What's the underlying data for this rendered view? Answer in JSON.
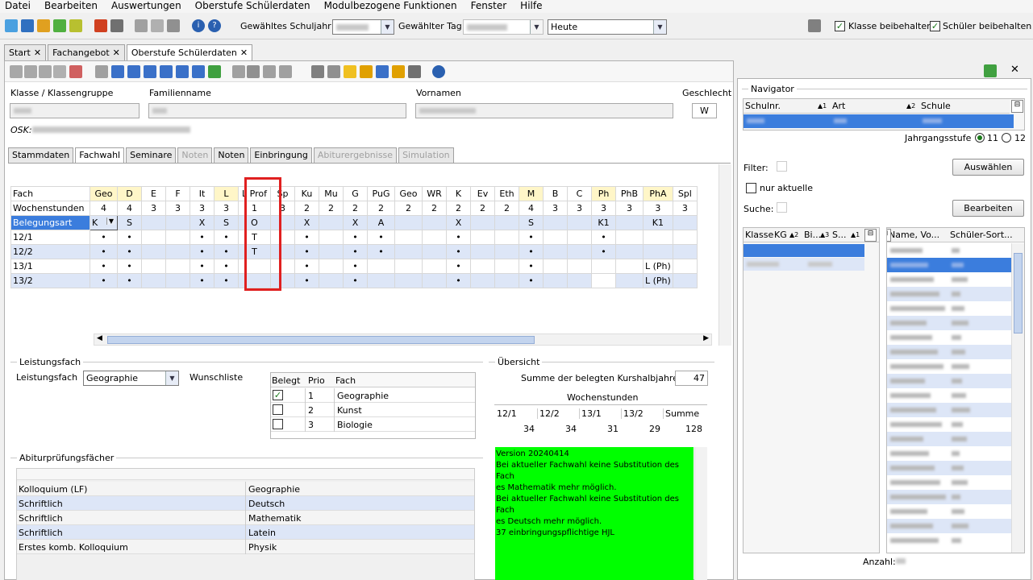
{
  "menu": [
    "Datei",
    "Bearbeiten",
    "Auswertungen",
    "Oberstufe Schülerdaten",
    "Modulbezogene Funktionen",
    "Fenster",
    "Hilfe"
  ],
  "toolbar": {
    "schuljahr_label": "Gewähltes Schuljahr",
    "tag_label": "Gewählter Tag",
    "heute_value": "Heute",
    "klasse_beibehalten": "Klasse beibehalten",
    "schueler_beibehalten": "Schüler beibehalten"
  },
  "tabs": [
    {
      "label": "Start"
    },
    {
      "label": "Fachangebot"
    },
    {
      "label": "Oberstufe Schülerdaten"
    }
  ],
  "student": {
    "klasse_label": "Klasse / Klassengruppe",
    "familienname_label": "Familienname",
    "vornamen_label": "Vornamen",
    "geschlecht_label": "Geschlecht",
    "geschlecht_value": "W",
    "osk_label": "OSK:"
  },
  "subtabs": [
    "Stammdaten",
    "Fachwahl",
    "Seminare",
    "Noten",
    "Noten",
    "Einbringung",
    "Abiturergebnisse",
    "Simulation"
  ],
  "grid": {
    "headers": [
      "Fach",
      "Geo",
      "D",
      "E",
      "F",
      "It",
      "L",
      "L Prof",
      "Sp",
      "Ku",
      "Mu",
      "G",
      "PuG",
      "Geo",
      "WR",
      "K",
      "Ev",
      "Eth",
      "M",
      "B",
      "C",
      "Ph",
      "PhB",
      "PhA",
      "Spl"
    ],
    "rows": [
      {
        "label": "Wochenstunden",
        "cells": [
          "4",
          "4",
          "3",
          "3",
          "3",
          "3",
          "1",
          "3",
          "2",
          "2",
          "2",
          "2",
          "2",
          "2",
          "2",
          "2",
          "2",
          "4",
          "3",
          "3",
          "3",
          "3",
          "3",
          "3"
        ]
      },
      {
        "label": "Belegungsart",
        "cells": [
          "K",
          "S",
          "",
          "",
          "X",
          "S",
          "O",
          "",
          "X",
          "",
          "X",
          "A",
          "",
          "",
          "X",
          "",
          "",
          "S",
          "",
          "",
          "K1",
          "",
          "K1",
          ""
        ]
      },
      {
        "label": "12/1",
        "cells": [
          "•",
          "•",
          "",
          "",
          "•",
          "•",
          "T",
          "",
          "•",
          "",
          "•",
          "•",
          "",
          "",
          "•",
          "",
          "",
          "•",
          "",
          "",
          "•",
          "",
          "",
          ""
        ]
      },
      {
        "label": "12/2",
        "cells": [
          "•",
          "•",
          "",
          "",
          "•",
          "•",
          "T",
          "",
          "•",
          "",
          "•",
          "•",
          "",
          "",
          "•",
          "",
          "",
          "•",
          "",
          "",
          "•",
          "",
          "",
          ""
        ]
      },
      {
        "label": "13/1",
        "cells": [
          "•",
          "•",
          "",
          "",
          "•",
          "•",
          "",
          "",
          "•",
          "",
          "•",
          "",
          "",
          "",
          "•",
          "",
          "",
          "•",
          "",
          "",
          "",
          "",
          "L (Ph)",
          ""
        ]
      },
      {
        "label": "13/2",
        "cells": [
          "•",
          "•",
          "",
          "",
          "•",
          "•",
          "",
          "",
          "•",
          "",
          "•",
          "",
          "",
          "",
          "•",
          "",
          "",
          "•",
          "",
          "",
          "",
          "",
          "L (Ph)",
          ""
        ]
      }
    ]
  },
  "leistungsfach": {
    "group_title": "Leistungsfach",
    "label": "Leistungsfach",
    "value": "Geographie",
    "wunschliste_label": "Wunschliste",
    "headers": [
      "Belegt",
      "Prio",
      "Fach"
    ],
    "rows": [
      {
        "checked": true,
        "prio": "1",
        "fach": "Geographie"
      },
      {
        "checked": false,
        "prio": "2",
        "fach": "Kunst"
      },
      {
        "checked": false,
        "prio": "3",
        "fach": "Biologie"
      }
    ]
  },
  "uebersicht": {
    "group_title": "Übersicht",
    "summe_label": "Summe der belegten Kurshalbjahre",
    "summe_value": "47",
    "wochenstunden_label": "Wochenstunden",
    "headers": [
      "12/1",
      "12/2",
      "13/1",
      "13/2",
      "Summe"
    ],
    "values": [
      "34",
      "34",
      "31",
      "29",
      "128"
    ]
  },
  "abitur": {
    "group_title": "Abiturprüfungsfächer",
    "rows": [
      {
        "art": "Kolloquium (LF)",
        "fach": "Geographie"
      },
      {
        "art": "Schriftlich",
        "fach": "Deutsch"
      },
      {
        "art": "Schriftlich",
        "fach": "Mathematik"
      },
      {
        "art": "Schriftlich",
        "fach": "Latein"
      },
      {
        "art": "Erstes komb. Kolloquium",
        "fach": "Physik"
      }
    ]
  },
  "messages": [
    "Version 20240414",
    "Bei aktueller Fachwahl keine Substitution des Fach",
    "es Mathematik mehr möglich.",
    "Bei aktueller Fachwahl keine Substitution des Fach",
    "es Deutsch mehr möglich.",
    "37 einbringungspflichtige HJL"
  ],
  "navigator": {
    "title": "Navigator",
    "headers": [
      "Schulnr.",
      "Art",
      "Schule"
    ],
    "jahrgangsstufe_label": "Jahrgangsstufe",
    "opt11": "11",
    "opt12": "12",
    "filter_label": "Filter:",
    "auswaehlen": "Auswählen",
    "nur_aktuelle": "nur aktuelle",
    "suche_label": "Suche:",
    "bearbeiten": "Bearbeiten",
    "left_headers": [
      "Klasse",
      "KG",
      "Bi...",
      "S..."
    ],
    "right_headers": [
      "Name, Vo...",
      "Schüler-Sort..."
    ],
    "anzahl_label": "Anzahl:"
  },
  "colors": {
    "highlight": "#3b7ddd",
    "yellow_header": "#fff6c8",
    "green_box": "#00ff00",
    "red_frame": "#e02020",
    "alt_row": "#dde6f7"
  }
}
